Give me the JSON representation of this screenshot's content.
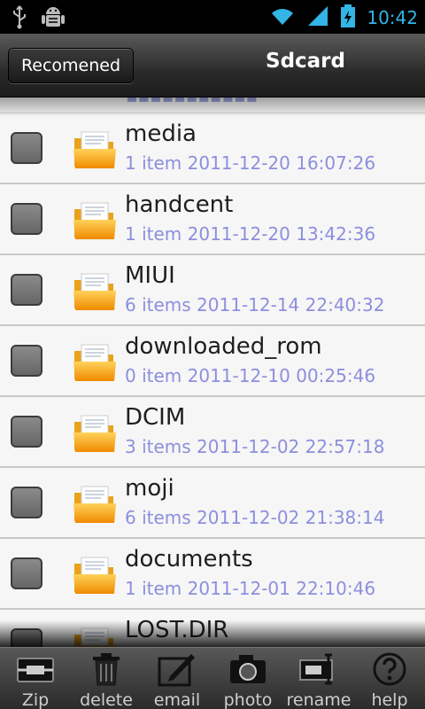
{
  "status_bar": {
    "time": "10:42",
    "icons": [
      "usb-icon",
      "android-debug-icon",
      "wifi-icon",
      "signal-icon",
      "battery-charging-icon"
    ],
    "accent": "#33b5e5"
  },
  "header": {
    "left_button": "Recomened",
    "title": "Sdcard"
  },
  "list": {
    "items": [
      {
        "name": "media",
        "meta": "1 item 2011-12-20 16:07:26"
      },
      {
        "name": "handcent",
        "meta": "1 item 2011-12-20 13:42:36"
      },
      {
        "name": "MIUI",
        "meta": "6 items 2011-12-14 22:40:32"
      },
      {
        "name": "downloaded_rom",
        "meta": "0 item 2011-12-10 00:25:46"
      },
      {
        "name": "DCIM",
        "meta": "3 items 2011-12-02 22:57:18"
      },
      {
        "name": "moji",
        "meta": "6 items 2011-12-02 21:38:14"
      },
      {
        "name": "documents",
        "meta": "1 item 2011-12-01 22:10:46"
      },
      {
        "name": "LOST.DIR",
        "meta": ""
      }
    ],
    "meta_color": "#8c8fdd"
  },
  "toolbar": {
    "zip": "Zip",
    "delete": "delete",
    "email": "email",
    "photo": "photo",
    "rename": "rename",
    "help": "help"
  }
}
